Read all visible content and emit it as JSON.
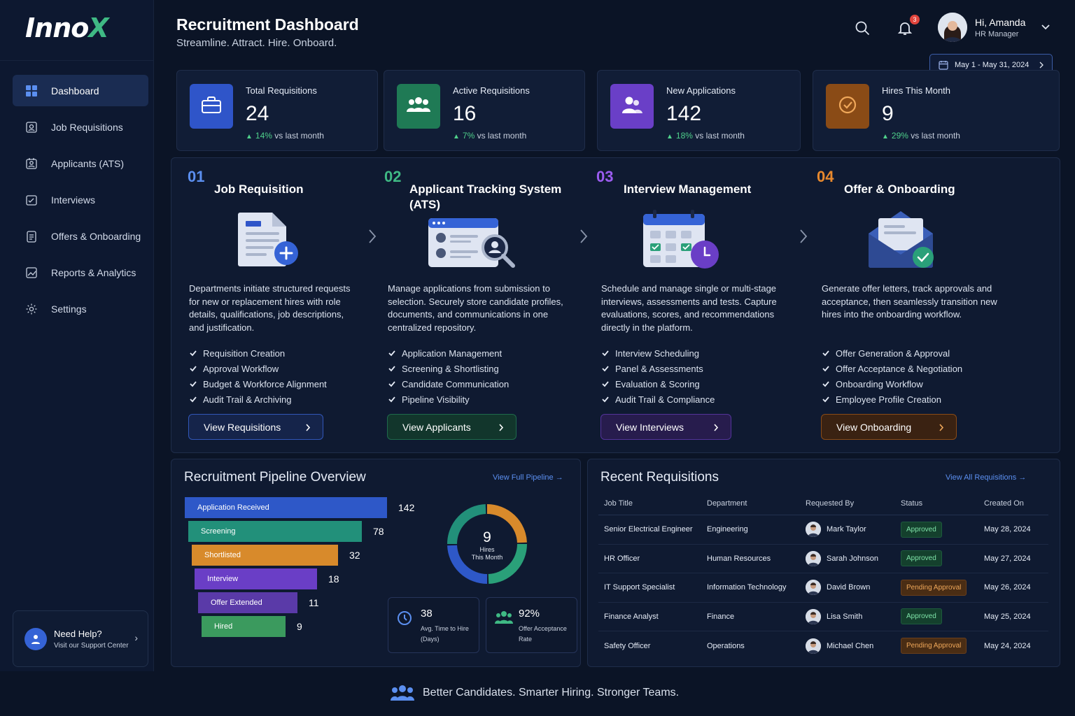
{
  "brand": {
    "logo_main": "Inno",
    "logo_x": "X"
  },
  "header": {
    "title": "Recruitment Dashboard",
    "subtitle": "Streamline. Attract. Hire. Onboard.",
    "notifications_count": "3",
    "user_greeting": "Hi, Amanda",
    "user_role": "HR Manager",
    "date_range": "May 1 - May 31, 2024"
  },
  "sidebar": {
    "items": [
      {
        "label": "Dashboard",
        "icon": "grid-icon",
        "active": true
      },
      {
        "label": "Job Requisitions",
        "icon": "requisition-icon"
      },
      {
        "label": "Applicants (ATS)",
        "icon": "applicants-icon"
      },
      {
        "label": "Interviews",
        "icon": "interviews-icon"
      },
      {
        "label": "Offers & Onboarding",
        "icon": "clipboard-icon"
      },
      {
        "label": "Reports & Analytics",
        "icon": "chart-icon"
      },
      {
        "label": "Settings",
        "icon": "gear-icon"
      }
    ],
    "help": {
      "title": "Need Help?",
      "subtitle": "Visit our Support Center"
    }
  },
  "stats": [
    {
      "label": "Total Requisitions",
      "value": "24",
      "delta": "14%",
      "delta_text": "vs last month",
      "color": "#2f55c9",
      "icon": "briefcase-icon"
    },
    {
      "label": "Active Requisitions",
      "value": "16",
      "delta": "7%",
      "delta_text": "vs last month",
      "color": "#1f7a55",
      "icon": "group-icon"
    },
    {
      "label": "New Applications",
      "value": "142",
      "delta": "18%",
      "delta_text": "vs last month",
      "color": "#6a3fc7",
      "icon": "users-icon"
    },
    {
      "label": "Hires This Month",
      "value": "9",
      "delta": "29%",
      "delta_text": "vs last month",
      "color": "#8a4b16",
      "icon": "check-circle-icon"
    }
  ],
  "modules": [
    {
      "num": "01",
      "title": "Job Requisition",
      "color": "#5b8ff0",
      "desc": "Departments initiate structured requests for new or replacement hires with role details, qualifications, job descriptions, and justification.",
      "features": [
        "Requisition Creation",
        "Approval Workflow",
        "Budget & Workforce Alignment",
        "Audit Trail & Archiving"
      ],
      "button": "View Requisitions"
    },
    {
      "num": "02",
      "title": "Applicant Tracking System (ATS)",
      "color": "#3fb984",
      "desc": "Manage applications from submission to selection. Securely store candidate profiles, documents, and communications in one centralized repository.",
      "features": [
        "Application Management",
        "Screening & Shortlisting",
        "Candidate Communication",
        "Pipeline Visibility"
      ],
      "button": "View Applicants"
    },
    {
      "num": "03",
      "title": "Interview Management",
      "color": "#9b5cf0",
      "desc": "Schedule and manage single or multi-stage interviews, assessments and tests. Capture evaluations, scores, and recommendations directly in the platform.",
      "features": [
        "Interview Scheduling",
        "Panel & Assessments",
        "Evaluation & Scoring",
        "Audit Trail & Compliance"
      ],
      "button": "View Interviews"
    },
    {
      "num": "04",
      "title": "Offer & Onboarding",
      "color": "#e8892d",
      "desc": "Generate offer letters, track approvals and acceptance, then seamlessly transition new hires into the onboarding workflow.",
      "features": [
        "Offer Generation & Approval",
        "Offer Acceptance & Negotiation",
        "Onboarding Workflow",
        "Employee Profile Creation"
      ],
      "button": "View Onboarding"
    }
  ],
  "pipeline": {
    "title": "Recruitment Pipeline Overview",
    "link": "View Full Pipeline",
    "stages": [
      {
        "label": "Application Received",
        "value": 142,
        "color": "#2e58c8"
      },
      {
        "label": "Screening",
        "value": 78,
        "color": "#22907a"
      },
      {
        "label": "Shortlisted",
        "value": 32,
        "color": "#d88a2b"
      },
      {
        "label": "Interview",
        "value": 18,
        "color": "#6a3ec6"
      },
      {
        "label": "Offer Extended",
        "value": 11,
        "color": "#5a3aa8"
      },
      {
        "label": "Hired",
        "value": 9,
        "color": "#3b9a5e"
      }
    ],
    "donut": {
      "value": "9",
      "label_line1": "Hires",
      "label_line2": "This Month",
      "segments": [
        {
          "color": "#d88a2b",
          "share": 0.25
        },
        {
          "color": "#2aa079",
          "share": 0.25
        },
        {
          "color": "#2e58c8",
          "share": 0.25
        },
        {
          "color": "#22907a",
          "share": 0.25
        }
      ]
    },
    "metrics": [
      {
        "value": "38",
        "label_line1": "Avg. Time to Hire",
        "label_line2": "(Days)",
        "icon": "clock-icon"
      },
      {
        "value": "92%",
        "label_line1": "Offer Acceptance",
        "label_line2": "Rate",
        "icon": "group-icon"
      }
    ]
  },
  "requisitions": {
    "title": "Recent Requisitions",
    "link": "View All Requisitions",
    "columns": [
      "Job Title",
      "Department",
      "Requested By",
      "Status",
      "Created On"
    ],
    "rows": [
      {
        "title": "Senior Electrical Engineer",
        "department": "Engineering",
        "requested_by": "Mark Taylor",
        "status": "Approved",
        "status_type": "ok",
        "created": "May 28, 2024"
      },
      {
        "title": "HR Officer",
        "department": "Human Resources",
        "requested_by": "Sarah Johnson",
        "status": "Approved",
        "status_type": "ok",
        "created": "May 27, 2024"
      },
      {
        "title": "IT Support Specialist",
        "department": "Information Technology",
        "requested_by": "David Brown",
        "status": "Pending Approval",
        "status_type": "pend",
        "created": "May 26, 2024"
      },
      {
        "title": "Finance Analyst",
        "department": "Finance",
        "requested_by": "Lisa Smith",
        "status": "Approved",
        "status_type": "ok",
        "created": "May 25, 2024"
      },
      {
        "title": "Safety Officer",
        "department": "Operations",
        "requested_by": "Michael Chen",
        "status": "Pending Approval",
        "status_type": "pend",
        "created": "May 24, 2024"
      }
    ]
  },
  "footer": {
    "tagline": "Better Candidates. Smarter Hiring. Stronger Teams."
  }
}
